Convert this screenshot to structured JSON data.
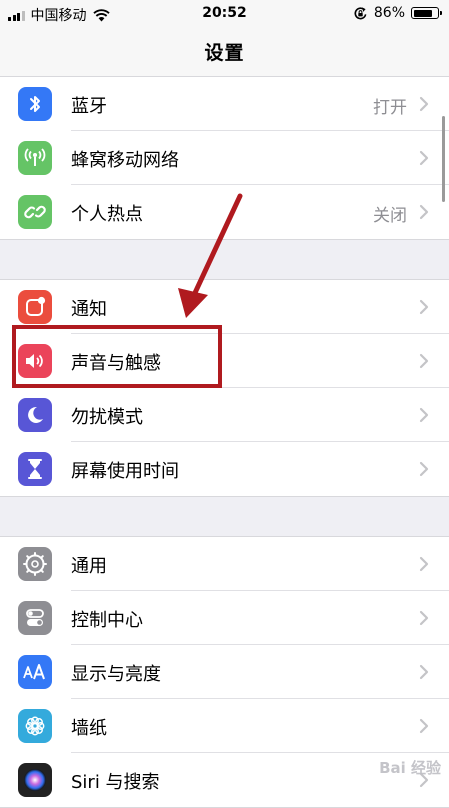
{
  "status_bar": {
    "carrier": "中国移动",
    "time": "20:52",
    "battery_percent": "86%",
    "battery_level": 0.86,
    "signal_bars_filled": 3
  },
  "nav": {
    "title": "设置"
  },
  "groups": [
    {
      "rows": [
        {
          "label": "蓝牙",
          "value": "打开",
          "icon": "bluetooth-icon",
          "color": "#3478f6"
        },
        {
          "label": "蜂窝移动网络",
          "value": "",
          "icon": "antenna-icon",
          "color": "#65c466"
        },
        {
          "label": "个人热点",
          "value": "关闭",
          "icon": "hotspot-link-icon",
          "color": "#65c466"
        }
      ]
    },
    {
      "rows": [
        {
          "label": "通知",
          "value": "",
          "icon": "notification-icon",
          "color": "#eb4d3d"
        },
        {
          "label": "声音与触感",
          "value": "",
          "icon": "speaker-icon",
          "color": "#eb445a"
        },
        {
          "label": "勿扰模式",
          "value": "",
          "icon": "moon-icon",
          "color": "#5856d6"
        },
        {
          "label": "屏幕使用时间",
          "value": "",
          "icon": "hourglass-icon",
          "color": "#5856d6"
        }
      ]
    },
    {
      "rows": [
        {
          "label": "通用",
          "value": "",
          "icon": "gear-icon",
          "color": "#8e8e93"
        },
        {
          "label": "控制中心",
          "value": "",
          "icon": "toggles-icon",
          "color": "#8e8e93"
        },
        {
          "label": "显示与亮度",
          "value": "",
          "icon": "text-size-icon",
          "color": "#3478f6"
        },
        {
          "label": "墙纸",
          "value": "",
          "icon": "flower-icon",
          "color": "#34aadc"
        },
        {
          "label": "Siri 与搜索",
          "value": "",
          "icon": "siri-icon",
          "color": "#222222"
        }
      ]
    }
  ],
  "annotation": {
    "highlight_color": "#b01a1f"
  },
  "watermark": "Bai 经验"
}
